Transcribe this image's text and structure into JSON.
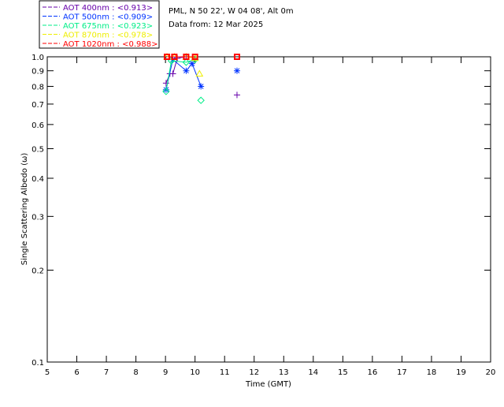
{
  "header": {
    "site": "PML, N 50 22', W 04 08', Alt 0m",
    "date": "Data from: 12 Mar 2025"
  },
  "chart_data": {
    "type": "line",
    "xlabel": "Time (GMT)",
    "ylabel": "Single Scattering Albedo (ω)",
    "xlim": [
      5,
      20
    ],
    "ylim": [
      0.1,
      1.0
    ],
    "yscale": "log",
    "xticks": [
      "5",
      "6",
      "7",
      "8",
      "9",
      "10",
      "11",
      "12",
      "13",
      "14",
      "15",
      "16",
      "17",
      "18",
      "19",
      "20"
    ],
    "yticks": [
      {
        "v": 1.0,
        "l": "1.0"
      },
      {
        "v": 0.9,
        "l": "0.9"
      },
      {
        "v": 0.8,
        "l": "0.8"
      },
      {
        "v": 0.7,
        "l": "0.7"
      },
      {
        "v": 0.6,
        "l": "0.6"
      },
      {
        "v": 0.5,
        "l": "0.5"
      },
      {
        "v": 0.4,
        "l": "0.4"
      },
      {
        "v": 0.3,
        "l": "0.3"
      },
      {
        "v": 0.2,
        "l": "0.2"
      },
      {
        "v": 0.1,
        "l": "0.1"
      }
    ],
    "legend_position": "top-left",
    "series": [
      {
        "name": "AOT  400nm : <0.913>",
        "color": "#6600aa",
        "marker": "plus",
        "x": [
          9.02,
          9.15,
          9.25,
          9.4,
          9.7,
          10.0,
          11.42
        ],
        "y": [
          0.82,
          0.88,
          0.88,
          0.99,
          1.0,
          1.0,
          0.75
        ]
      },
      {
        "name": "AOT  500nm : <0.909>",
        "color": "#0033ff",
        "marker": "star",
        "x": [
          9.02,
          9.25,
          9.7,
          9.9,
          10.2,
          11.42
        ],
        "y": [
          0.78,
          0.98,
          0.9,
          0.95,
          0.8,
          0.9
        ]
      },
      {
        "name": "AOT  675nm : <0.923>",
        "color": "#00ee88",
        "marker": "diamond",
        "x": [
          9.02,
          9.2,
          9.7,
          10.0,
          10.2
        ],
        "y": [
          0.77,
          0.97,
          0.96,
          0.98,
          0.72
        ]
      },
      {
        "name": "AOT  870nm : <0.978>",
        "color": "#eeee00",
        "marker": "triangle",
        "x": [
          9.05,
          9.3,
          9.7,
          10.0,
          10.15
        ],
        "y": [
          1.0,
          1.0,
          1.0,
          0.99,
          0.88
        ]
      },
      {
        "name": "AOT 1020nm : <0.988>",
        "color": "#ff0000",
        "marker": "square",
        "x": [
          9.05,
          9.3,
          9.7,
          10.0,
          11.42
        ],
        "y": [
          1.0,
          1.0,
          1.0,
          1.0,
          1.0
        ]
      }
    ]
  }
}
